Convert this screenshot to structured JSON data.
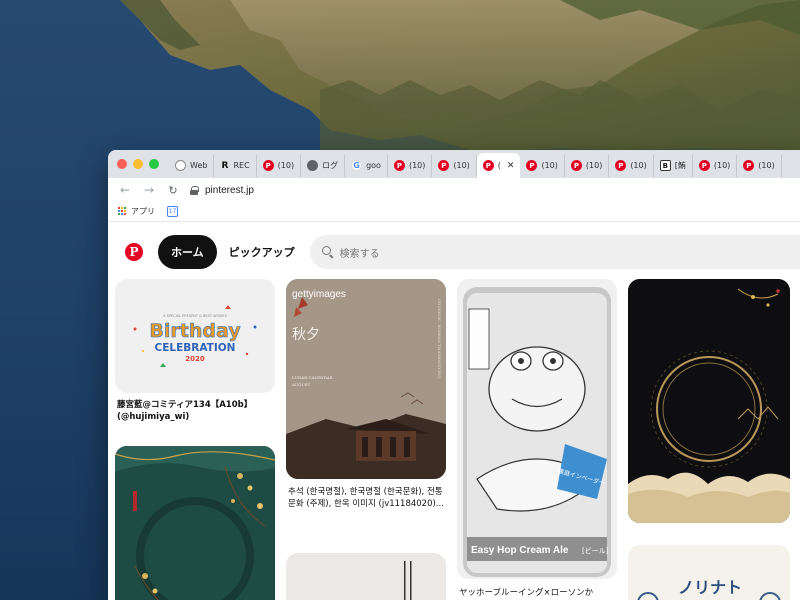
{
  "browser": {
    "tabs": [
      {
        "icon": "web-icon",
        "label": "Web"
      },
      {
        "icon": "r-icon",
        "label": "REC"
      },
      {
        "icon": "pinterest-icon",
        "label": "(10)"
      },
      {
        "icon": "globe-icon",
        "label": "ログ"
      },
      {
        "icon": "google-icon",
        "label": "goo"
      },
      {
        "icon": "pinterest-icon",
        "label": "(10)"
      },
      {
        "icon": "pinterest-icon",
        "label": "(10)"
      },
      {
        "icon": "pinterest-icon",
        "label": "(",
        "active": true
      },
      {
        "icon": "pinterest-icon",
        "label": "(10)"
      },
      {
        "icon": "pinterest-icon",
        "label": "(10)"
      },
      {
        "icon": "pinterest-icon",
        "label": "(10)"
      },
      {
        "icon": "b-icon",
        "label": "[鮪"
      },
      {
        "icon": "pinterest-icon",
        "label": "(10)"
      },
      {
        "icon": "pinterest-icon",
        "label": "(10)"
      }
    ],
    "url": "pinterest.jp",
    "bookmarks": {
      "apps_label": "アプリ",
      "calendar_day": "17"
    }
  },
  "pinterest": {
    "logo": "P",
    "home_label": "ホーム",
    "pickup_label": "ピックアップ",
    "search_placeholder": "検索する",
    "pins": {
      "birthday": {
        "top_text": "A SPECIAL PRESENT & BEST WISHES",
        "birthday_text": "Birthday",
        "celebration_text": "CELEBRATION",
        "year": "2020",
        "caption": "藤宮藍@コミティア134【A10b】(@hujimiya_wi)"
      },
      "getty": {
        "brand": "gettyimages",
        "title": "秋夕",
        "sub1": "LUNAR CALENDAR",
        "sub2": "AUGUST",
        "side": "CHUSEOK · KOREAN THANKSGIVING",
        "caption": "추석 (한국명절), 한국명절 (한국문화), 전통문화 (주제), 한옥 이미지 (jv11184020)..."
      },
      "beer": {
        "label": "Easy Hop Cream Ale",
        "label_suffix": "[ビール]",
        "badge": "裏庭インベーダー",
        "caption": "ヤッホーブルーイング×ローソンか"
      },
      "noritake": {
        "text": "ノリナト"
      }
    }
  },
  "colors": {
    "pinterest_red": "#e60023",
    "home_bg": "#111111"
  }
}
